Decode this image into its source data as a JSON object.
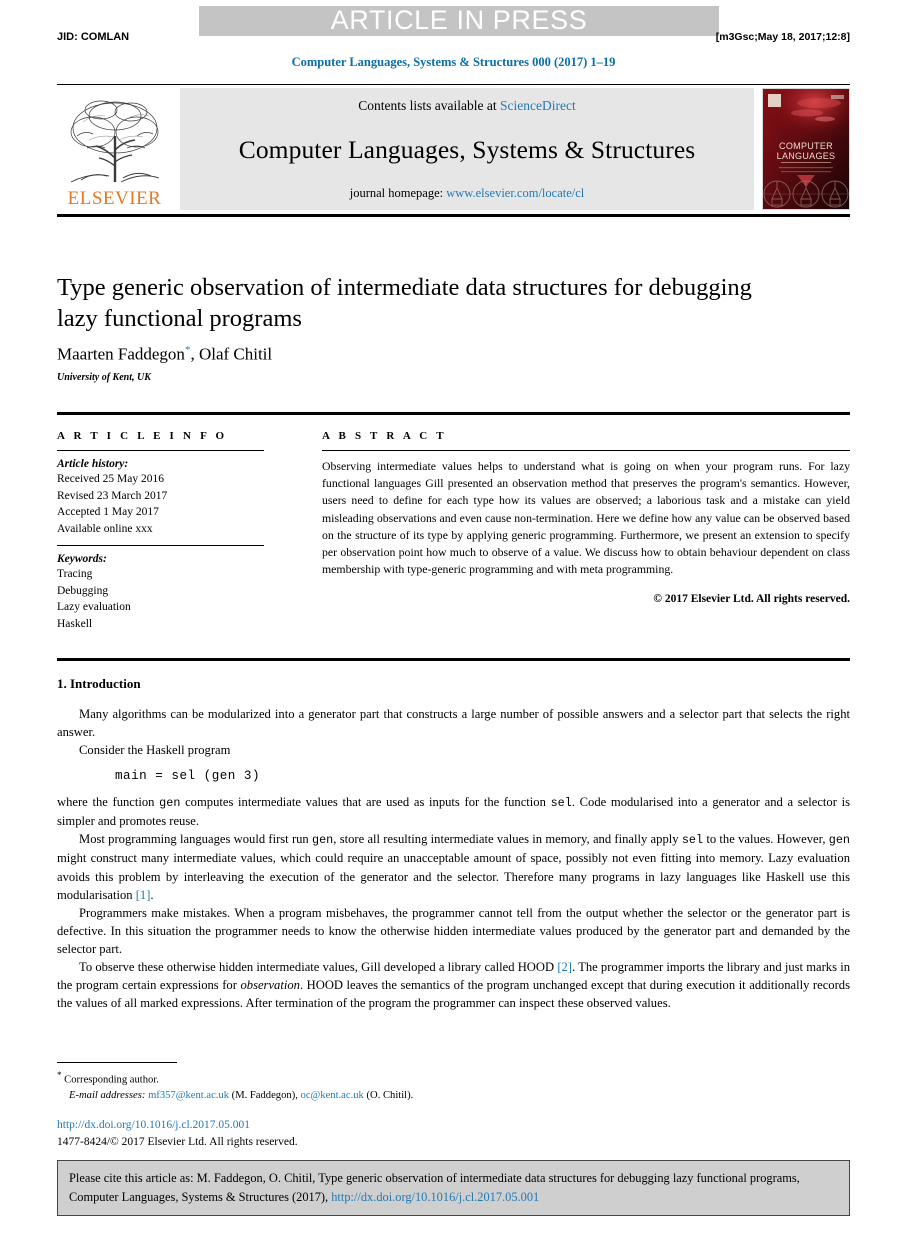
{
  "banner_notice": "ARTICLE IN PRESS",
  "stamp": {
    "jid": "JID: COMLAN",
    "version": "[m3Gsc;May 18, 2017;12:8]"
  },
  "running_head": "Computer Languages, Systems & Structures 000 (2017) 1–19",
  "masthead": {
    "publisher_wordmark": "ELSEVIER",
    "contents_prefix": "Contents lists available at ",
    "contents_link": "ScienceDirect",
    "journal_title": "Computer Languages, Systems & Structures",
    "homepage_prefix": "journal homepage: ",
    "homepage_link": "www.elsevier.com/locate/cl",
    "cover_line1": "COMPUTER",
    "cover_line2": "LANGUAGES"
  },
  "article": {
    "title": "Type generic observation of intermediate data structures for debugging lazy functional programs",
    "authors_part1": "Maarten Faddegon",
    "author_marker": "*",
    "authors_part2": ", Olaf Chitil",
    "affiliation": "University of Kent, UK"
  },
  "info": {
    "heading": "A R T I C L E   I N F O",
    "history_label": "Article history:",
    "history": [
      "Received 25 May 2016",
      "Revised 23 March 2017",
      "Accepted 1 May 2017",
      "Available online xxx"
    ],
    "keywords_label": "Keywords:",
    "keywords": [
      "Tracing",
      "Debugging",
      "Lazy evaluation",
      "Haskell"
    ]
  },
  "abstract": {
    "heading": "A B S T R A C T",
    "text": "Observing intermediate values helps to understand what is going on when your program runs. For lazy functional languages Gill presented an observation method that preserves the program's semantics. However, users need to define for each type how its values are observed; a laborious task and a mistake can yield misleading observations and even cause non-termination. Here we define how any value can be observed based on the structure of its type by applying generic programming. Furthermore, we present an extension to specify per observation point how much to observe of a value. We discuss how to obtain behaviour dependent on class membership with type-generic programming and with meta programming.",
    "copyright": "© 2017 Elsevier Ltd. All rights reserved."
  },
  "body": {
    "section_heading": "1. Introduction",
    "p1": "Many algorithms can be modularized into a generator part that constructs a large number of possible answers and a selector part that selects the right answer.",
    "p2": "Consider the Haskell program",
    "code": "main = sel (gen 3)",
    "p3_a": "where the function ",
    "p3_code1": "gen",
    "p3_b": " computes intermediate values that are used as inputs for the function ",
    "p3_code2": "sel",
    "p3_c": ". Code modularised into a generator and a selector is simpler and promotes reuse.",
    "p4_a": "Most programming languages would first run ",
    "p4_code1": "gen",
    "p4_b": ", store all resulting intermediate values in memory, and finally apply ",
    "p4_code2": "sel",
    "p4_c": " to the values. However, ",
    "p4_code3": "gen",
    "p4_d": " might construct many intermediate values, which could require an unacceptable amount of space, possibly not even fitting into memory. Lazy evaluation avoids this problem by interleaving the execution of the generator and the selector. Therefore many programs in lazy languages like Haskell use this modularisation ",
    "p4_cite": "[1]",
    "p4_e": ".",
    "p5": "Programmers make mistakes. When a program misbehaves, the programmer cannot tell from the output whether the selector or the generator part is defective. In this situation the programmer needs to know the otherwise hidden intermediate values produced by the generator part and demanded by the selector part.",
    "p6_a": "To observe these otherwise hidden intermediate values, Gill developed a library called HOOD ",
    "p6_cite": "[2]",
    "p6_b": ". The programmer imports the library and just marks in the program certain expressions for ",
    "p6_em": "observation",
    "p6_c": ". HOOD leaves the semantics of the program unchanged except that during execution it additionally records the values of all marked expressions. After termination of the program the programmer can inspect these observed values."
  },
  "footnotes": {
    "corresponding_marker": "*",
    "corresponding": "Corresponding author.",
    "email_label": "E-mail addresses:",
    "email1": "mf357@kent.ac.uk",
    "email1_owner": "(M. Faddegon),",
    "email2": "oc@kent.ac.uk",
    "email2_owner": "(O. Chitil).",
    "doi": "http://dx.doi.org/10.1016/j.cl.2017.05.001",
    "issn_line": "1477-8424/© 2017 Elsevier Ltd. All rights reserved."
  },
  "cite_box": {
    "text_a": "Please cite this article as: M. Faddegon, O. Chitil, Type generic observation of intermediate data structures for debugging lazy functional programs, Computer Languages, Systems & Structures (2017), ",
    "link": "http://dx.doi.org/10.1016/j.cl.2017.05.001"
  },
  "colors": {
    "link_blue": "#1f7ab5",
    "heading_blue": "#0b6ea8",
    "elsevier_orange": "#e87722",
    "banner_gray": "#c4c4c4",
    "masthead_gray": "#e6e6e6",
    "citebox_gray": "#cfcfcf"
  }
}
